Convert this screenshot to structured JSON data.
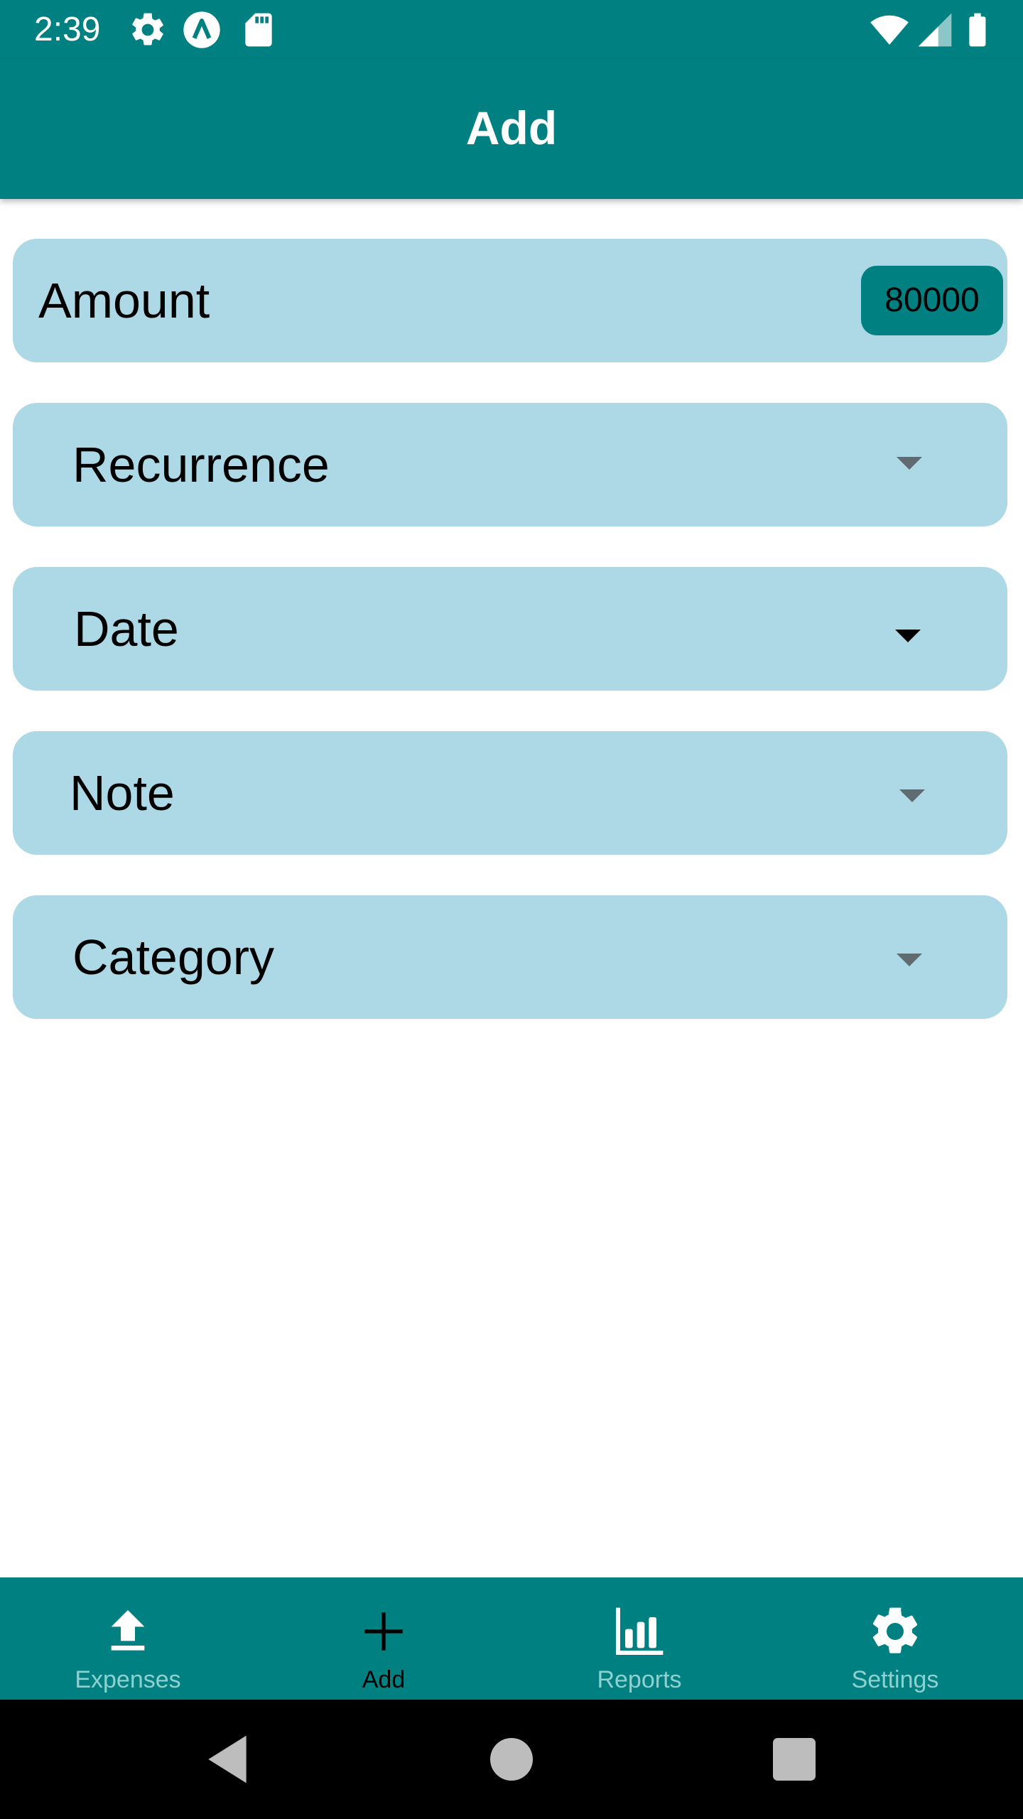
{
  "status_bar": {
    "time": "2:39",
    "left_icons": [
      "gear-icon",
      "a-logo-icon",
      "sd-card-icon"
    ],
    "right_icons": [
      "wifi-icon",
      "cellular-icon",
      "battery-icon"
    ]
  },
  "app_bar": {
    "title": "Add"
  },
  "form": {
    "amount": {
      "label": "Amount",
      "value": "80000"
    },
    "recurrence": {
      "label": "Recurrence"
    },
    "date": {
      "label": "Date"
    },
    "note": {
      "label": "Note"
    },
    "category": {
      "label": "Category"
    }
  },
  "bottom_nav": {
    "items": [
      {
        "label": "Expenses",
        "icon": "upload-icon",
        "active": false
      },
      {
        "label": "Add",
        "icon": "plus-icon",
        "active": true
      },
      {
        "label": "Reports",
        "icon": "bar-chart-icon",
        "active": false
      },
      {
        "label": "Settings",
        "icon": "gear-icon",
        "active": false
      }
    ]
  },
  "system_nav": {
    "buttons": [
      "back-icon",
      "home-icon",
      "recents-icon"
    ]
  },
  "colors": {
    "primary": "#008080",
    "field_background": "#add8e6",
    "inactive_nav_label": "#8fd0d0"
  }
}
